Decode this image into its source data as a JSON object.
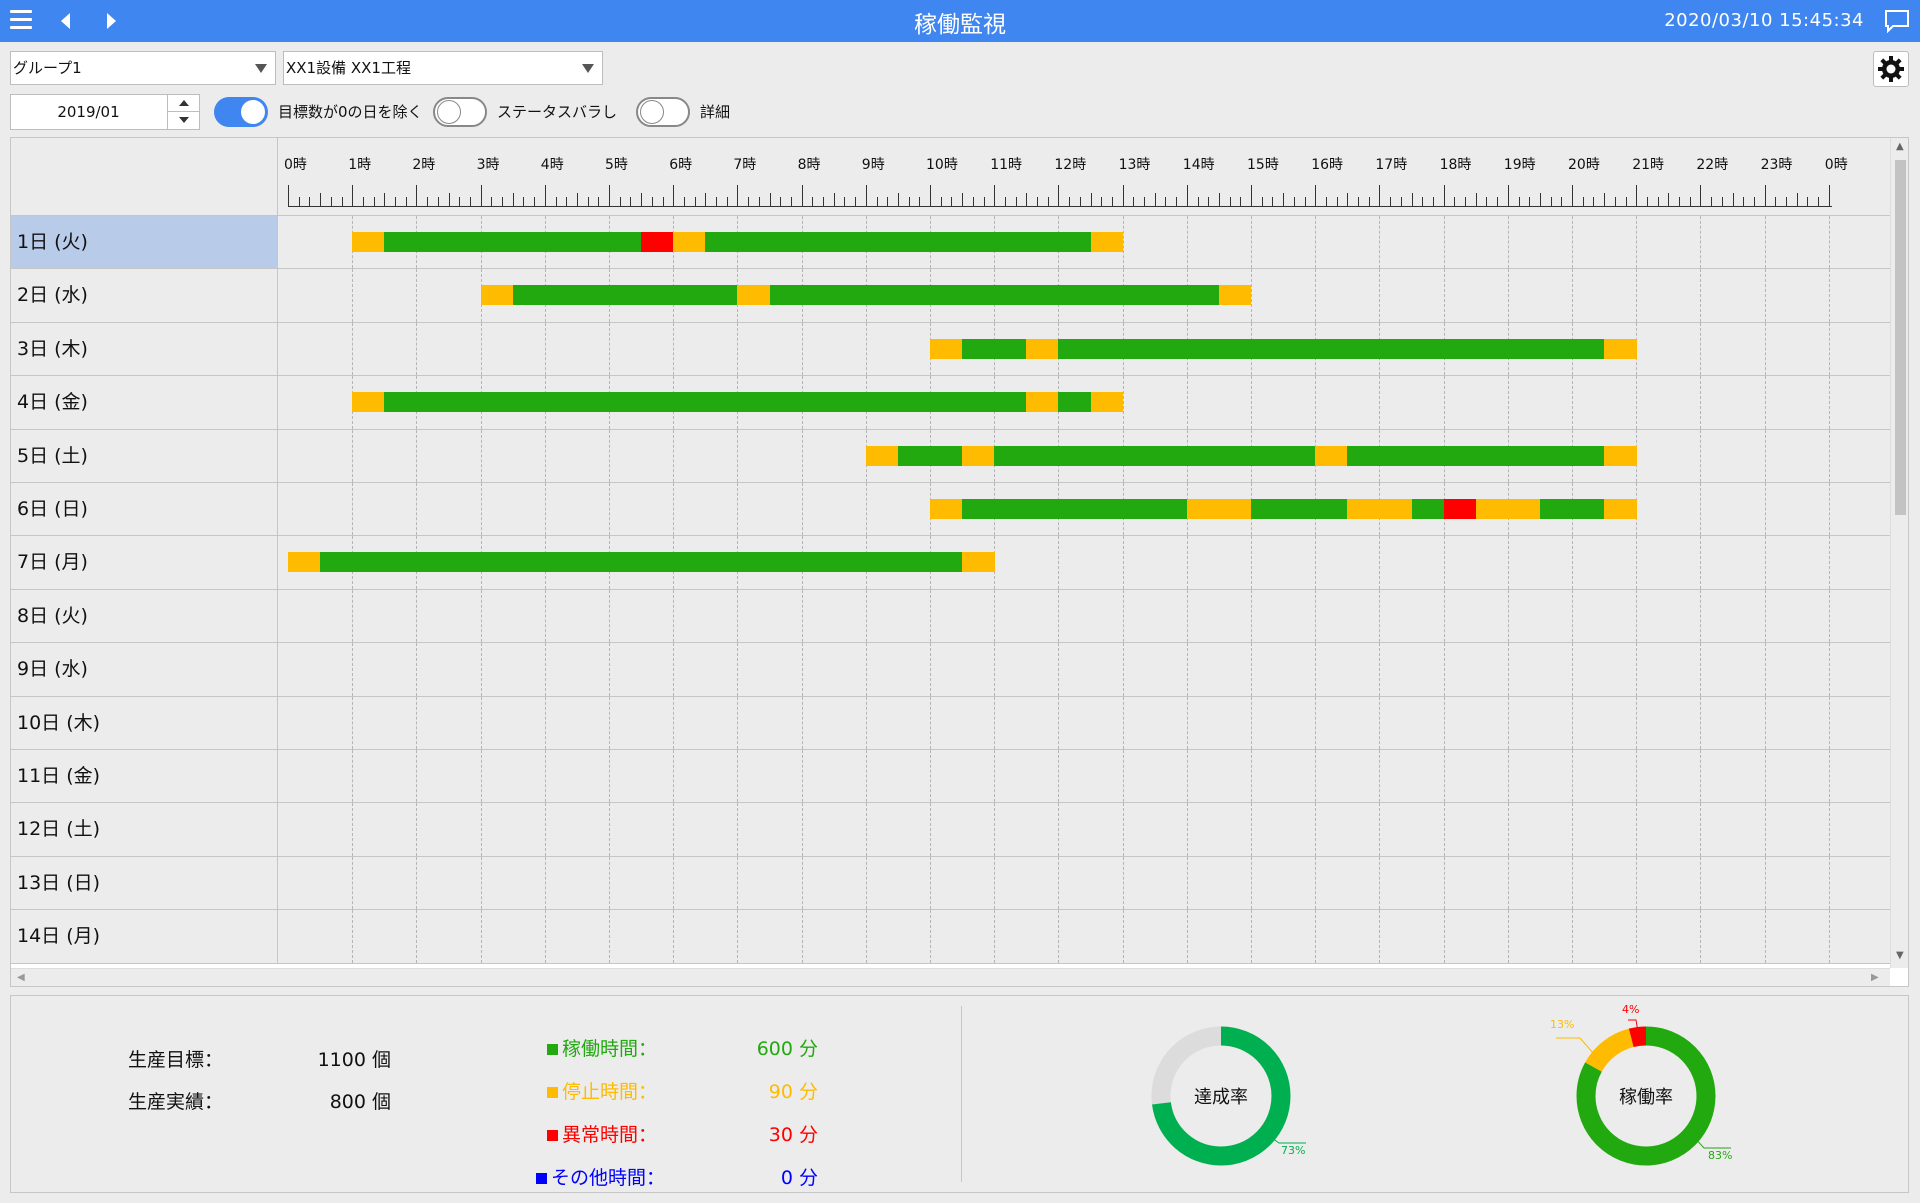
{
  "app": {
    "title": "稼働監視",
    "datetime": "2020/03/10 15:45:34"
  },
  "controls": {
    "group": "グループ1",
    "equipment": "XX1設備 XX1工程",
    "month": "2019/01",
    "toggles": [
      {
        "label": "目標数が0の日を除く",
        "on": true
      },
      {
        "label": "ステータスバラし",
        "on": false
      },
      {
        "label": "詳細",
        "on": false
      }
    ]
  },
  "gantt": {
    "hours": [
      "0時",
      "1時",
      "2時",
      "3時",
      "4時",
      "5時",
      "6時",
      "7時",
      "8時",
      "9時",
      "10時",
      "11時",
      "12時",
      "13時",
      "14時",
      "15時",
      "16時",
      "17時",
      "18時",
      "19時",
      "20時",
      "21時",
      "22時",
      "23時",
      "0時"
    ],
    "colors": {
      "run": "#21a90f",
      "stop": "#ffbb00",
      "error": "#ff0000",
      "other": "#0000ff"
    },
    "rows": [
      {
        "label": "1日 (火)",
        "selected": true,
        "segments": [
          {
            "s": 1.0,
            "e": 1.5,
            "t": "stop"
          },
          {
            "s": 1.5,
            "e": 5.5,
            "t": "run"
          },
          {
            "s": 5.5,
            "e": 6.0,
            "t": "error"
          },
          {
            "s": 6.0,
            "e": 6.5,
            "t": "stop"
          },
          {
            "s": 6.5,
            "e": 12.5,
            "t": "run"
          },
          {
            "s": 12.5,
            "e": 13.0,
            "t": "stop"
          }
        ]
      },
      {
        "label": "2日 (水)",
        "segments": [
          {
            "s": 3.0,
            "e": 3.5,
            "t": "stop"
          },
          {
            "s": 3.5,
            "e": 7.0,
            "t": "run"
          },
          {
            "s": 7.0,
            "e": 7.5,
            "t": "stop"
          },
          {
            "s": 7.5,
            "e": 14.5,
            "t": "run"
          },
          {
            "s": 14.5,
            "e": 15.0,
            "t": "stop"
          }
        ]
      },
      {
        "label": "3日 (木)",
        "segments": [
          {
            "s": 10.0,
            "e": 10.5,
            "t": "stop"
          },
          {
            "s": 10.5,
            "e": 11.5,
            "t": "run"
          },
          {
            "s": 11.5,
            "e": 12.0,
            "t": "stop"
          },
          {
            "s": 12.0,
            "e": 20.5,
            "t": "run"
          },
          {
            "s": 20.5,
            "e": 21.0,
            "t": "stop"
          }
        ]
      },
      {
        "label": "4日 (金)",
        "segments": [
          {
            "s": 1.0,
            "e": 1.5,
            "t": "stop"
          },
          {
            "s": 1.5,
            "e": 11.5,
            "t": "run"
          },
          {
            "s": 11.5,
            "e": 12.0,
            "t": "stop"
          },
          {
            "s": 12.0,
            "e": 12.5,
            "t": "run"
          },
          {
            "s": 12.5,
            "e": 13.0,
            "t": "stop"
          }
        ]
      },
      {
        "label": "5日 (土)",
        "segments": [
          {
            "s": 9.0,
            "e": 9.5,
            "t": "stop"
          },
          {
            "s": 9.5,
            "e": 10.5,
            "t": "run"
          },
          {
            "s": 10.5,
            "e": 11.0,
            "t": "stop"
          },
          {
            "s": 11.0,
            "e": 16.0,
            "t": "run"
          },
          {
            "s": 16.0,
            "e": 16.5,
            "t": "stop"
          },
          {
            "s": 16.5,
            "e": 20.5,
            "t": "run"
          },
          {
            "s": 20.5,
            "e": 21.0,
            "t": "stop"
          }
        ]
      },
      {
        "label": "6日 (日)",
        "segments": [
          {
            "s": 10.0,
            "e": 10.5,
            "t": "stop"
          },
          {
            "s": 10.5,
            "e": 14.0,
            "t": "run"
          },
          {
            "s": 14.0,
            "e": 15.0,
            "t": "stop"
          },
          {
            "s": 15.0,
            "e": 16.5,
            "t": "run"
          },
          {
            "s": 16.5,
            "e": 17.5,
            "t": "stop"
          },
          {
            "s": 17.5,
            "e": 18.0,
            "t": "run"
          },
          {
            "s": 18.0,
            "e": 18.5,
            "t": "error"
          },
          {
            "s": 18.5,
            "e": 19.5,
            "t": "stop"
          },
          {
            "s": 19.5,
            "e": 20.5,
            "t": "run"
          },
          {
            "s": 20.5,
            "e": 21.0,
            "t": "stop"
          }
        ]
      },
      {
        "label": "7日 (月)",
        "segments": [
          {
            "s": 0.0,
            "e": 0.5,
            "t": "stop"
          },
          {
            "s": 0.5,
            "e": 10.5,
            "t": "run"
          },
          {
            "s": 10.5,
            "e": 11.0,
            "t": "stop"
          }
        ]
      },
      {
        "label": "8日 (火)",
        "segments": []
      },
      {
        "label": "9日 (水)",
        "segments": []
      },
      {
        "label": "10日 (木)",
        "segments": []
      },
      {
        "label": "11日 (金)",
        "segments": []
      },
      {
        "label": "12日 (土)",
        "segments": []
      },
      {
        "label": "13日 (日)",
        "segments": []
      },
      {
        "label": "14日 (月)",
        "segments": []
      }
    ]
  },
  "summary": {
    "target_label": "生産目標：",
    "target_value": "1100 個",
    "actual_label": "生産実績：",
    "actual_value": "800 個",
    "run_label": "稼働時間：",
    "run_value": "600 分",
    "stop_label": "停止時間：",
    "stop_value": "90 分",
    "error_label": "異常時間：",
    "error_value": "30 分",
    "other_label": "その他時間：",
    "other_value": "0 分",
    "achievement": {
      "label": "達成率",
      "pct_label": "73%",
      "value": 73,
      "color": "#00b050"
    },
    "utilization": {
      "label": "稼働率",
      "run_pct": "83%",
      "stop_pct": "13%",
      "error_pct": "4%",
      "run": 83,
      "stop": 13,
      "error": 4
    }
  }
}
